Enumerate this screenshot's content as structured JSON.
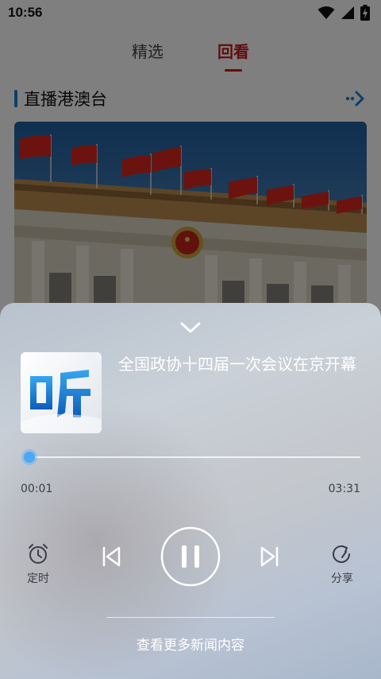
{
  "status_bar": {
    "time": "10:56",
    "icons": [
      "wifi-icon",
      "cell-signal-icon",
      "battery-charging-icon"
    ]
  },
  "tabs": [
    {
      "label": "精选",
      "active": false
    },
    {
      "label": "回看",
      "active": true
    }
  ],
  "section": {
    "title": "直播港澳台",
    "more_icon": "double-arrow-right-icon"
  },
  "player": {
    "collapse_icon": "chevron-down-icon",
    "cover_logo_text": "听",
    "track_title": "全国政协十四届一次会议在京开幕",
    "current_time": "00:01",
    "total_time": "03:31",
    "progress": 0.005,
    "controls": {
      "timer_label": "定时",
      "share_label": "分享",
      "play_state": "playing"
    },
    "more_news": "查看更多新闻内容"
  },
  "colors": {
    "accent": "#c8161d",
    "section_bar": "#1a7fd4",
    "progress": "#2196f3"
  }
}
